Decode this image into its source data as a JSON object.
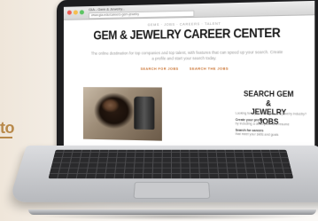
{
  "background": {
    "partial_link_text": "to"
  },
  "browser": {
    "tab_title": "GIA - Gem & Jewelry...",
    "url": "www.gia.edu/careers-gem-jewelry"
  },
  "site": {
    "eyebrow": "GEMS · JOBS · CAREERS · TALENT",
    "title": "GEM & JEWELRY CAREER CENTER",
    "intro": "The online destination for top companies and top talent, with features that can speed up your search. Create a profile and start your search today.",
    "cta_primary": "SEARCH FOR JOBS",
    "cta_secondary": "SEARCH THE JOBS",
    "search_title_line1": "SEARCH GEM &",
    "search_title_line2": "JEWELRY JOBS",
    "side_intro": "Looking for a job in the gem and jewelry industry?",
    "side_item1_title": "Create your profile",
    "side_item1_text": "by including a description and resume",
    "side_item2_title": "Search for careers",
    "side_item2_text": "that meet your skills and goals"
  },
  "colors": {
    "accent": "#c9702d",
    "partial_link": "#b8894a"
  }
}
